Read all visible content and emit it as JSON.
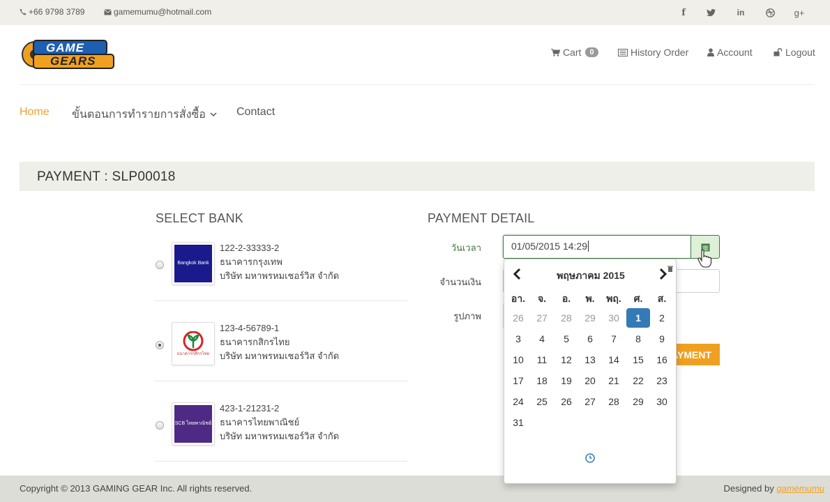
{
  "topbar": {
    "phone": "+66 9798 3789",
    "email": "gamemumu@hotmail.com",
    "social": [
      "f",
      "t",
      "in",
      "◎",
      "g+"
    ]
  },
  "header": {
    "logo_text_top": "GAME",
    "logo_text_bottom": "GEARS",
    "cart_label": "Cart",
    "cart_count": "0",
    "history_label": "History Order",
    "account_label": "Account",
    "logout_label": "Logout"
  },
  "menu": {
    "home": "Home",
    "steps": "ขั้นตอนการทำรายการสั่งซื้อ",
    "contact": "Contact"
  },
  "page": {
    "title": "PAYMENT : SLP00018"
  },
  "banks_section": {
    "title": "SELECT BANK",
    "banks": [
      {
        "account": "122-2-33333-2",
        "bank_name": "ธนาคารกรุงเทพ",
        "holder": "บริษัท มหาพรหมเชอร์วิส จำกัด",
        "logo_text": "Bangkok Bank",
        "color": "#1a1a8c",
        "selected": false
      },
      {
        "account": "123-4-56789-1",
        "bank_name": "ธนาคารกสิกรไทย",
        "holder": "บริษัท มหาพรหมเชอร์วิส จำกัด",
        "logo_text": "ธนาคารกสิกรไทย",
        "color": "#ffffff",
        "selected": true
      },
      {
        "account": "423-1-21231-2",
        "bank_name": "ธนาคารไทยพาณิชย์",
        "holder": "บริษัท มหาพรหมเชอร์วิส จำกัด",
        "logo_text": "SCB ไทยพาณิชย์",
        "color": "#4e2a84",
        "selected": false
      }
    ]
  },
  "payment_section": {
    "title": "PAYMENT DETAIL",
    "datetime_label": "วันเวลา",
    "datetime_value": "01/05/2015 14:29",
    "amount_label": "จำนวนเงิน",
    "image_label": "รูปภาพ",
    "submit_label": "AYMENT"
  },
  "datepicker": {
    "month_title": "พฤษภาคม 2015",
    "weekdays": [
      "อา.",
      "จ.",
      "อ.",
      "พ.",
      "พฤ.",
      "ศ.",
      "ส."
    ],
    "weeks": [
      [
        "26",
        "27",
        "28",
        "29",
        "30",
        "1",
        "2"
      ],
      [
        "3",
        "4",
        "5",
        "6",
        "7",
        "8",
        "9"
      ],
      [
        "10",
        "11",
        "12",
        "13",
        "14",
        "15",
        "16"
      ],
      [
        "17",
        "18",
        "19",
        "20",
        "21",
        "22",
        "23"
      ],
      [
        "24",
        "25",
        "26",
        "27",
        "28",
        "29",
        "30"
      ],
      [
        "31"
      ]
    ],
    "selected_day": "1",
    "old_days_first_row": 5
  },
  "footer": {
    "copyright": "Copyright © 2013 GAMING GEAR Inc. All rights reserved.",
    "designed_by": "Designed by",
    "designer": "gamemumu"
  },
  "colors": {
    "accent": "#f0a020",
    "success": "#3c763d",
    "primary": "#337ab7"
  }
}
